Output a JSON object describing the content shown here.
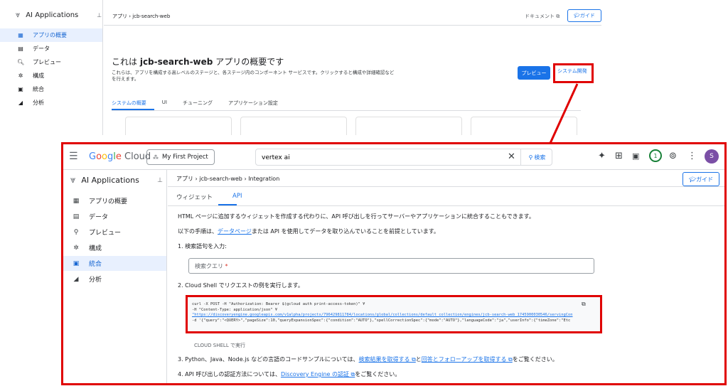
{
  "background": {
    "brand": "AI Applications",
    "nav": [
      {
        "label": "アプリの概要",
        "icon": "dashboard-icon",
        "glyph": "▦",
        "active": true
      },
      {
        "label": "データ",
        "icon": "data-icon",
        "glyph": "▤",
        "active": false
      },
      {
        "label": "プレビュー",
        "icon": "search-icon",
        "glyph": "🔍︎",
        "active": false
      },
      {
        "label": "構成",
        "icon": "gear-icon",
        "glyph": "✲",
        "active": false
      },
      {
        "label": "統合",
        "icon": "integration-icon",
        "glyph": "▣",
        "active": false
      },
      {
        "label": "分析",
        "icon": "analytics-icon",
        "glyph": "◢",
        "active": false
      }
    ],
    "breadcrumb": [
      "アプリ",
      "jcb-search-web"
    ],
    "doc_link": "ドキュメント ⧉",
    "guide": "ガイド",
    "title_pre": "これは ",
    "title_bold": "jcb-search-web",
    "title_post": " アプリの概要です",
    "description": "これらは、アプリを構成する高レベルのステージと、各ステージ内のコンポーネント サービスです。クリックすると構成や詳細確認などを行えます。",
    "preview_button": "プレビュー",
    "sysdev_button": "システム開発",
    "tabs": [
      "システムの概要",
      "UI",
      "チューニング",
      "アプリケーション設定"
    ]
  },
  "window": {
    "logo": {
      "G": "G",
      "o1": "o",
      "o2": "o",
      "g": "g",
      "l": "l",
      "e": "e",
      "cloud": " Cloud"
    },
    "project": "My First Project",
    "search_value": "vertex ai",
    "search_button": "検索",
    "notifications": "1",
    "avatar": "S",
    "brand": "AI Applications",
    "nav": [
      {
        "label": "アプリの概要",
        "icon": "dashboard-icon",
        "glyph": "▦",
        "active": false
      },
      {
        "label": "データ",
        "icon": "data-icon",
        "glyph": "▤",
        "active": false
      },
      {
        "label": "プレビュー",
        "icon": "search-icon",
        "glyph": "⚲",
        "active": false
      },
      {
        "label": "構成",
        "icon": "gear-icon",
        "glyph": "✲",
        "active": false
      },
      {
        "label": "統合",
        "icon": "integration-icon",
        "glyph": "▣",
        "active": true
      },
      {
        "label": "分析",
        "icon": "analytics-icon",
        "glyph": "◢",
        "active": false
      }
    ],
    "breadcrumb": [
      "アプリ",
      "jcb-search-web",
      "Integration"
    ],
    "guide": "ガイド",
    "tabs": [
      "ウィジェット",
      "API"
    ],
    "intro": "HTML ページに追加するウィジェットを作成する代わりに、API 呼び出しを行ってサーバーやアプリケーションに統合することもできます。",
    "premise_pre": "以下の手順は、",
    "premise_link": "データページ",
    "premise_post": "または API を使用してデータを取り込んでいることを前提としています。",
    "step1": "1.  検索語句を入力:",
    "field_placeholder": "検索クエリ",
    "field_required": " *",
    "step2": "2.  Cloud Shell でリクエストの例を実行します。",
    "code_line1": "curl -X POST -H \"Authorization: Bearer $(gcloud auth print-access-token)\" ¥",
    "code_line2": "-H \"Content-Type: application/json\" ¥",
    "code_line3": "\"https://discoveryengine.googleapis.com/v1alpha/projects/796429811784/locations/global/collections/default_collection/engines/jcb-search-web_1745900030546/servingCon",
    "code_line4": "-d '{\"query\":\"<QUERY>\",\"pageSize\":10,\"queryExpansionSpec\":{\"condition\":\"AUTO\"},\"spellCorrectionSpec\":{\"mode\":\"AUTO\"},\"languageCode\":\"ja\",\"userInfo\":{\"timeZone\":\"Etc",
    "cloud_shell_button": "CLOUD SHELL で実行",
    "step3_pre": "3.  Python、Java、Node.js などの言語のコードサンプルについては、",
    "step3_link1": "検索結果を取得する ⧉",
    "step3_mid": "と",
    "step3_link2": "回答とフォローアップを取得する ⧉",
    "step3_post": "をご覧ください。",
    "step4_pre": "4.  API 呼び出しの認証方法については、",
    "step4_link": "Discovery Engine の認証 ⧉",
    "step4_post": "をご覧ください。"
  },
  "colors": {
    "accent": "#1a73e8",
    "highlight": "#e00000"
  }
}
